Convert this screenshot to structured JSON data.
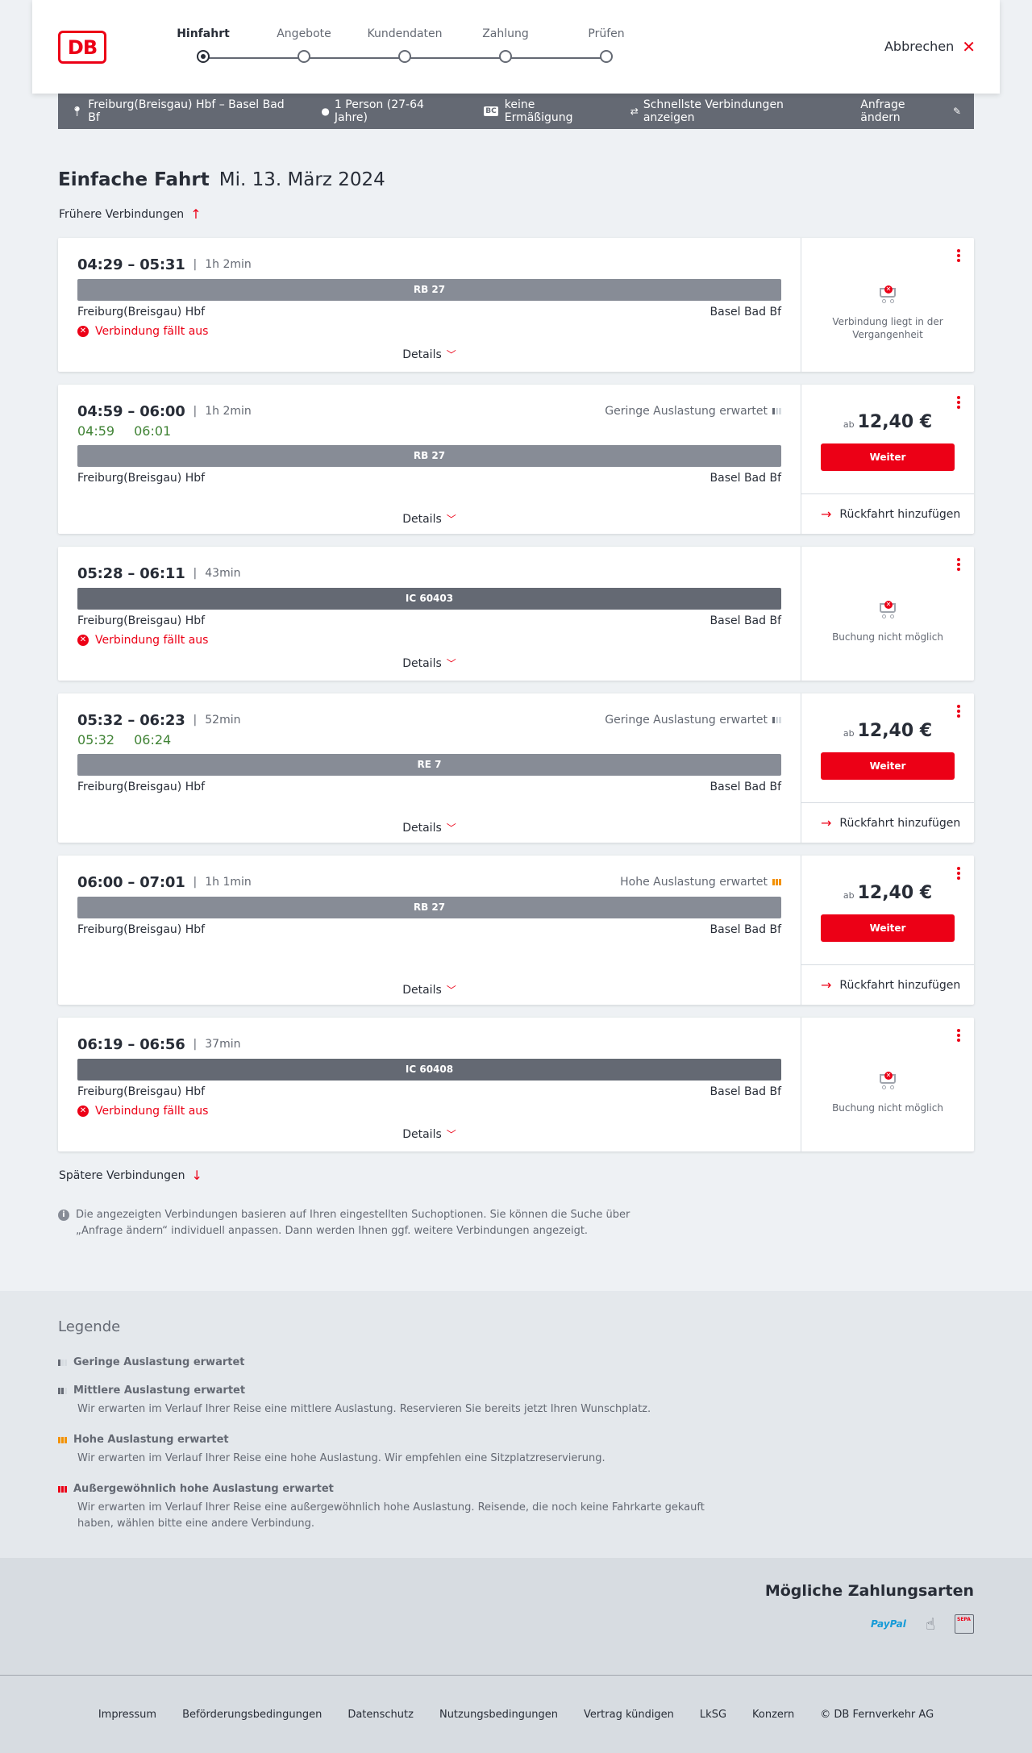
{
  "header": {
    "logo": "DB",
    "steps": [
      {
        "label": "Hinfahrt",
        "active": true
      },
      {
        "label": "Angebote",
        "active": false
      },
      {
        "label": "Kundendaten",
        "active": false
      },
      {
        "label": "Zahlung",
        "active": false
      },
      {
        "label": "Prüfen",
        "active": false
      }
    ],
    "cancel_label": "Abbrechen"
  },
  "infobar": {
    "route": "Freiburg(Breisgau) Hbf – Basel Bad Bf",
    "passengers": "1 Person (27-64 Jahre)",
    "bahncard_badge": "BC",
    "discount": "keine Ermäßigung",
    "option": "Schnellste Verbindungen anzeigen",
    "change_label": "Anfrage ändern"
  },
  "title": "Einfache Fahrt",
  "date": "Mi. 13. März 2024",
  "earlier_label": "Frühere Verbindungen",
  "later_label": "Spätere Verbindungen",
  "details_label": "Details",
  "price_prefix": "ab",
  "weiter_label": "Weiter",
  "return_label": "Rückfahrt hinzufügen",
  "connections": [
    {
      "times": "04:29 – 05:31",
      "duration": "1h 2min",
      "train": "RB 27",
      "from": "Freiburg(Breisgau) Hbf",
      "to": "Basel Bad Bf",
      "cancelled_text": "Verbindung fällt aus",
      "unavailable_text": "Verbindung liegt in der Vergangenheit"
    },
    {
      "times": "04:59 – 06:00",
      "duration": "1h 2min",
      "load": "Geringe Auslastung erwartet",
      "rt_dep": "04:59",
      "rt_arr": "06:01",
      "train": "RB 27",
      "from": "Freiburg(Breisgau) Hbf",
      "to": "Basel Bad Bf",
      "price": "12,40 €"
    },
    {
      "times": "05:28 – 06:11",
      "duration": "43min",
      "train": "IC 60403",
      "from": "Freiburg(Breisgau) Hbf",
      "to": "Basel Bad Bf",
      "cancelled_text": "Verbindung fällt aus",
      "unavailable_text": "Buchung nicht möglich"
    },
    {
      "times": "05:32 – 06:23",
      "duration": "52min",
      "load": "Geringe Auslastung erwartet",
      "rt_dep": "05:32",
      "rt_arr": "06:24",
      "train": "RE 7",
      "from": "Freiburg(Breisgau) Hbf",
      "to": "Basel Bad Bf",
      "price": "12,40 €"
    },
    {
      "times": "06:00 – 07:01",
      "duration": "1h 1min",
      "load": "Hohe Auslastung erwartet",
      "train": "RB 27",
      "from": "Freiburg(Breisgau) Hbf",
      "to": "Basel Bad Bf",
      "price": "12,40 €"
    },
    {
      "times": "06:19 – 06:56",
      "duration": "37min",
      "train": "IC 60408",
      "from": "Freiburg(Breisgau) Hbf",
      "to": "Basel Bad Bf",
      "cancelled_text": "Verbindung fällt aus",
      "unavailable_text": "Buchung nicht möglich"
    }
  ],
  "disclaimer": "Die angezeigten Verbindungen basieren auf Ihren eingestellten Suchoptionen. Sie können die Suche über „Anfrage ändern“ individuell anpassen. Dann werden Ihnen ggf. weitere Verbindungen angezeigt.",
  "legend": {
    "title": "Legende",
    "items": [
      {
        "title": "Geringe Auslastung erwartet",
        "text": ""
      },
      {
        "title": "Mittlere Auslastung erwartet",
        "text": "Wir erwarten im Verlauf Ihrer Reise eine mittlere Auslastung. Reservieren Sie bereits jetzt Ihren Wunschplatz."
      },
      {
        "title": "Hohe Auslastung erwartet",
        "text": "Wir erwarten im Verlauf Ihrer Reise eine hohe Auslastung. Wir empfehlen eine Sitzplatzreservierung."
      },
      {
        "title": "Außergewöhnlich hohe Auslastung erwartet",
        "text": "Wir erwarten im Verlauf Ihrer Reise eine außergewöhnlich hohe Auslastung. Reisende, die noch keine Fahrkarte gekauft haben, wählen bitte eine andere Verbindung."
      }
    ]
  },
  "payment": {
    "title": "Mögliche Zahlungsarten",
    "paypal_1": "Pay",
    "paypal_2": "Pal",
    "sepa": "SEPA"
  },
  "footer": [
    "Impressum",
    "Beförderungsbedingungen",
    "Datenschutz",
    "Nutzungsbedingungen",
    "Vertrag kündigen",
    "LkSG",
    "Konzern",
    "© DB Fernverkehr AG"
  ],
  "colors": {
    "brand_red": "#ec0016",
    "realtime_green": "#408335",
    "high_load_orange": "#f39200"
  }
}
